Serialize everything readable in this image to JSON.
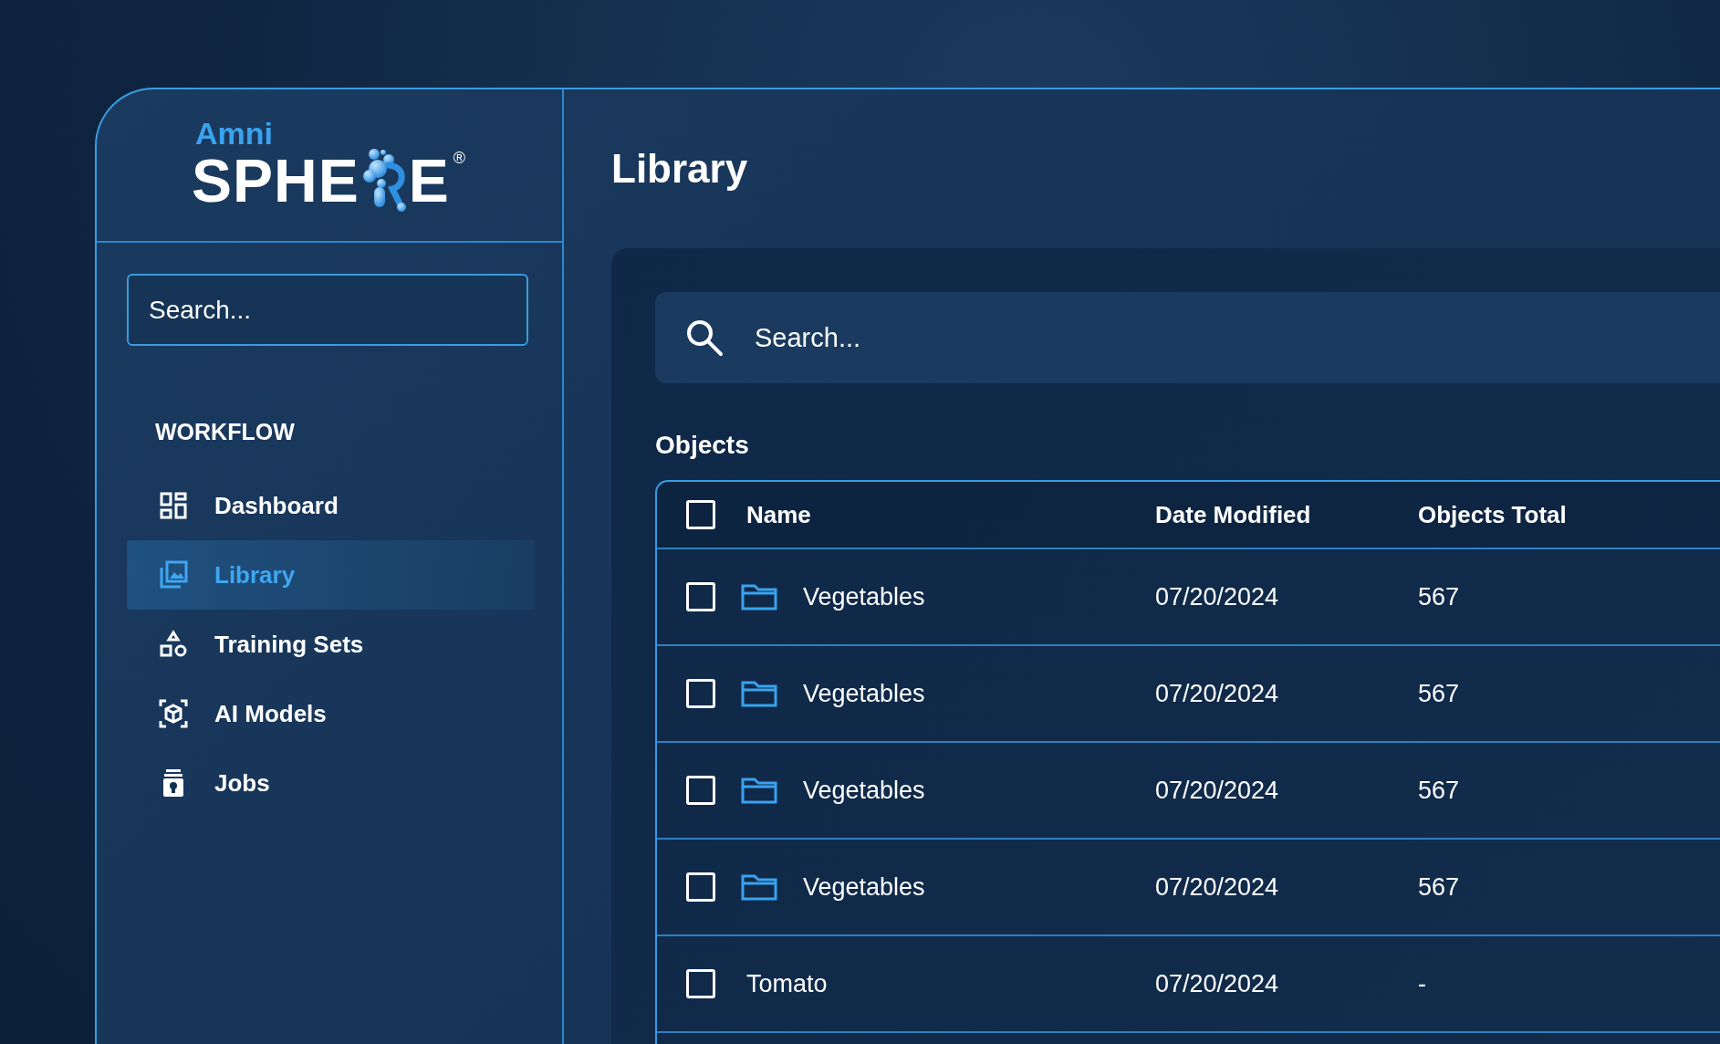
{
  "logo": {
    "top": "Amni",
    "word_start": "SPHE",
    "word_end": "E",
    "registered": "®"
  },
  "sidebar": {
    "search": {
      "placeholder": "Search..."
    },
    "section": "WORKFLOW",
    "items": [
      {
        "label": "Dashboard",
        "selected": false
      },
      {
        "label": "Library",
        "selected": true
      },
      {
        "label": "Training Sets",
        "selected": false
      },
      {
        "label": "AI Models",
        "selected": false
      },
      {
        "label": "Jobs",
        "selected": false
      }
    ]
  },
  "page": {
    "title": "Library"
  },
  "search": {
    "placeholder": "Search..."
  },
  "objects": {
    "title": "Objects",
    "header_checked": false,
    "columns": [
      "Name",
      "Date Modified",
      "Objects Total"
    ],
    "rows": [
      {
        "kind": "folder",
        "checked": false,
        "name": "Vegetables",
        "date": "07/20/2024",
        "total": "567"
      },
      {
        "kind": "folder",
        "checked": false,
        "name": "Vegetables",
        "date": "07/20/2024",
        "total": "567"
      },
      {
        "kind": "folder",
        "checked": false,
        "name": "Vegetables",
        "date": "07/20/2024",
        "total": "567"
      },
      {
        "kind": "folder",
        "checked": false,
        "name": "Vegetables",
        "date": "07/20/2024",
        "total": "567"
      },
      {
        "kind": "item",
        "checked": false,
        "name": "Tomato",
        "date": "07/20/2024",
        "total": "-"
      }
    ]
  }
}
